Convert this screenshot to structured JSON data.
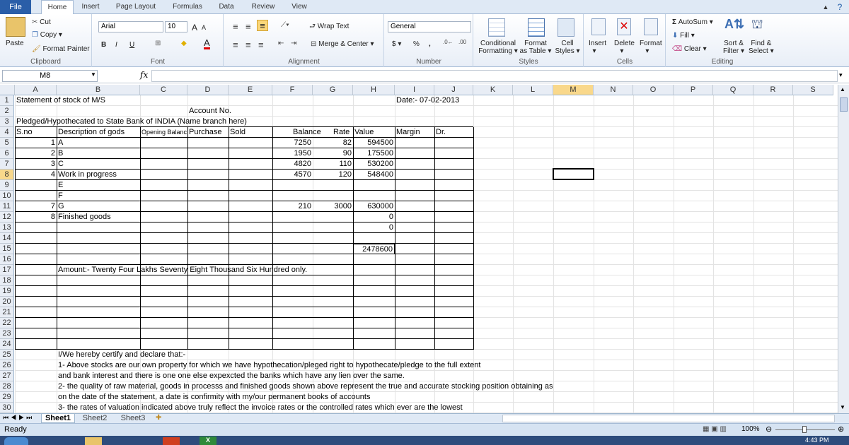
{
  "ribbon_tabs": [
    "File",
    "Home",
    "Insert",
    "Page Layout",
    "Formulas",
    "Data",
    "Review",
    "View"
  ],
  "clipboard": {
    "paste": "Paste",
    "cut": "Cut",
    "copy": "Copy",
    "format_painter": "Format Painter",
    "label": "Clipboard"
  },
  "font": {
    "name": "Arial",
    "size": "10",
    "bold": "B",
    "italic": "I",
    "underline": "U",
    "grow": "A",
    "shrink": "A",
    "color_letter": "A",
    "label": "Font"
  },
  "alignment": {
    "wrap": "Wrap Text",
    "merge": "Merge & Center",
    "label": "Alignment"
  },
  "number": {
    "format": "General",
    "currency": "$",
    "percent": "%",
    "comma": ",",
    "label": "Number"
  },
  "styles": {
    "conditional": "Conditional",
    "conditional2": "Formatting",
    "format_table": "Format",
    "format_table2": "as Table",
    "cell_styles": "Cell",
    "cell_styles2": "Styles",
    "label": "Styles"
  },
  "cells": {
    "insert": "Insert",
    "delete": "Delete",
    "format": "Format",
    "label": "Cells"
  },
  "editing": {
    "autosum": "AutoSum",
    "fill": "Fill",
    "clear": "Clear",
    "sort": "Sort &",
    "sort2": "Filter",
    "find": "Find &",
    "find2": "Select",
    "label": "Editing"
  },
  "formula_bar": {
    "name_box": "M8",
    "fx": "fx",
    "content": ""
  },
  "columns": [
    "A",
    "B",
    "C",
    "D",
    "E",
    "F",
    "G",
    "H",
    "I",
    "J",
    "K",
    "L",
    "M",
    "N",
    "O",
    "P",
    "Q",
    "R",
    "S"
  ],
  "rows": [
    "1",
    "2",
    "3",
    "4",
    "5",
    "6",
    "7",
    "8",
    "9",
    "10",
    "11",
    "12",
    "13",
    "14",
    "15",
    "16",
    "17",
    "18",
    "19",
    "20",
    "21",
    "22",
    "23",
    "24",
    "25",
    "26",
    "27",
    "28",
    "29",
    "30"
  ],
  "sheet": {
    "title": "Statement of stock of M/S",
    "date": "Date:- 07-02-2013",
    "account_no": "Account No.",
    "pledged": "Pledged/Hypothecated to State Bank of INDIA (Name branch here)",
    "headers": {
      "sno": "S.no",
      "desc": "Description of gods",
      "opening": "Opening Balanc",
      "purchase": "Purchase",
      "sold": "Sold",
      "balance": "Balance",
      "rate": "Rate",
      "value": "Value",
      "margin": "Margin",
      "dr": "Dr."
    },
    "items": [
      {
        "sno": "1",
        "desc": "A",
        "balance": "7250",
        "rate": "82",
        "value": "594500"
      },
      {
        "sno": "2",
        "desc": "B",
        "balance": "1950",
        "rate": "90",
        "value": "175500"
      },
      {
        "sno": "3",
        "desc": "C",
        "balance": "4820",
        "rate": "110",
        "value": "530200"
      },
      {
        "sno": "4",
        "desc": "Work in progress",
        "balance": "4570",
        "rate": "120",
        "value": "548400"
      },
      {
        "sno": "",
        "desc": "E",
        "balance": "",
        "rate": "",
        "value": ""
      },
      {
        "sno": "",
        "desc": "F",
        "balance": "",
        "rate": "",
        "value": ""
      },
      {
        "sno": "7",
        "desc": "G",
        "balance": "210",
        "rate": "3000",
        "value": "630000"
      },
      {
        "sno": "8",
        "desc": "Finished goods",
        "balance": "",
        "rate": "",
        "value": "0"
      },
      {
        "sno": "",
        "desc": "",
        "balance": "",
        "rate": "",
        "value": "0"
      }
    ],
    "total": "2478600",
    "amount": "Amount:- Twenty Four  Lakhs Seventy Eight Thousand Six Hundred   only.",
    "cert": [
      "I/We hereby certify and declare that:-",
      "1- Above stocks are our own property for which we have hypothecation/pleged right to hypothecate/pledge to the full extent",
      "and bank interest and there is one one else expexcted the banks which have any lien over the same.",
      "2- the quality of raw material, goods in processs and finished goods shown above represent the true and accurate stocking position obtaining as",
      "on the date of the statement, a date is confirmity with my/our permanent books of accounts",
      "3- the rates of valuation indicated above truly reflect the invoice rates or the controlled rates which ever are the lowest"
    ]
  },
  "sheet_tabs": [
    "Sheet1",
    "Sheet2",
    "Sheet3"
  ],
  "status": {
    "ready": "Ready",
    "zoom": "100%",
    "time": "4:43 PM"
  },
  "colors": {
    "file_tab": "#2a5ea8",
    "selected_header": "#f9d88b"
  }
}
